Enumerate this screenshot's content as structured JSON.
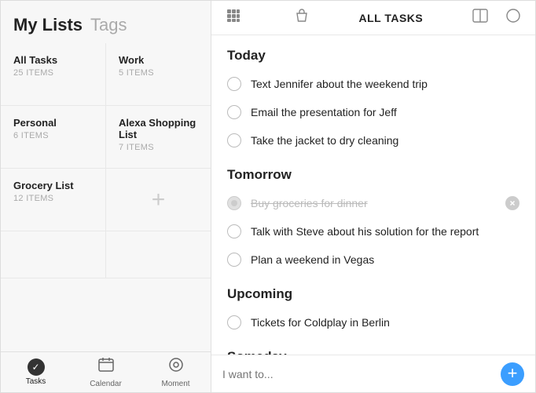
{
  "sidebar": {
    "title_my_lists": "My Lists",
    "title_tags": "Tags",
    "lists": [
      {
        "id": "all-tasks",
        "name": "All Tasks",
        "count": "25 ITEMS"
      },
      {
        "id": "work",
        "name": "Work",
        "count": "5 ITEMS"
      },
      {
        "id": "personal",
        "name": "Personal",
        "count": "6 ITEMS"
      },
      {
        "id": "alexa-shopping",
        "name": "Alexa Shopping List",
        "count": "7 ITEMS"
      },
      {
        "id": "grocery",
        "name": "Grocery List",
        "count": "12 ITEMS"
      }
    ]
  },
  "header": {
    "title": "ALL TASKS",
    "grid_icon": "⠿",
    "bag_icon": "🛍",
    "split_icon": "⊡",
    "options_icon": "○"
  },
  "sections": [
    {
      "label": "Today",
      "tasks": [
        {
          "id": "t1",
          "text": "Text Jennifer about the weekend trip",
          "completed": false,
          "deleting": false
        },
        {
          "id": "t2",
          "text": "Email the presentation for Jeff",
          "completed": false,
          "deleting": false
        },
        {
          "id": "t3",
          "text": "Take the jacket to dry cleaning",
          "completed": false,
          "deleting": false
        }
      ]
    },
    {
      "label": "Tomorrow",
      "tasks": [
        {
          "id": "t4",
          "text": "Buy groceries for dinner",
          "completed": true,
          "deleting": true
        },
        {
          "id": "t5",
          "text": "Talk with Steve about his solution for the report",
          "completed": false,
          "deleting": false
        },
        {
          "id": "t6",
          "text": "Plan a weekend in Vegas",
          "completed": false,
          "deleting": false
        }
      ]
    },
    {
      "label": "Upcoming",
      "tasks": [
        {
          "id": "t7",
          "text": "Tickets for Coldplay in Berlin",
          "completed": false,
          "deleting": false
        }
      ]
    },
    {
      "label": "Someday",
      "tasks": []
    }
  ],
  "input_bar": {
    "placeholder": "I want to..."
  },
  "bottom_nav": [
    {
      "id": "tasks",
      "label": "Tasks",
      "active": true
    },
    {
      "id": "calendar",
      "label": "Calendar",
      "active": false
    },
    {
      "id": "moment",
      "label": "Moment",
      "active": false
    }
  ]
}
